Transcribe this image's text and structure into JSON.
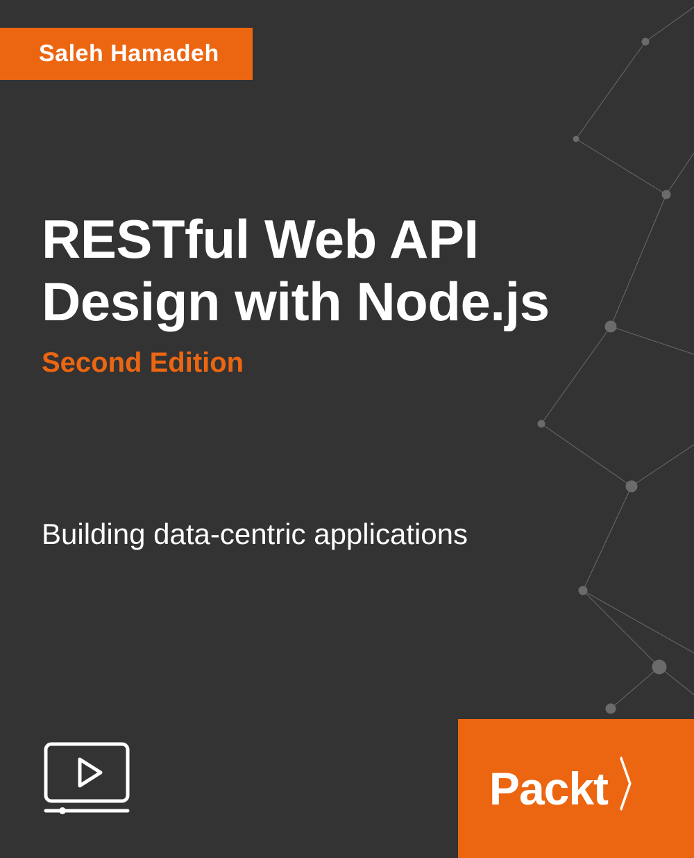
{
  "author": "Saleh Hamadeh",
  "title_line1": "RESTful Web API",
  "title_line2": "Design with Node.js",
  "edition": "Second Edition",
  "subtitle": "Building data-centric applications",
  "publisher": "Packt",
  "colors": {
    "brand_orange": "#ec6611",
    "bg_dark": "#333333",
    "text_light": "#ffffff"
  }
}
